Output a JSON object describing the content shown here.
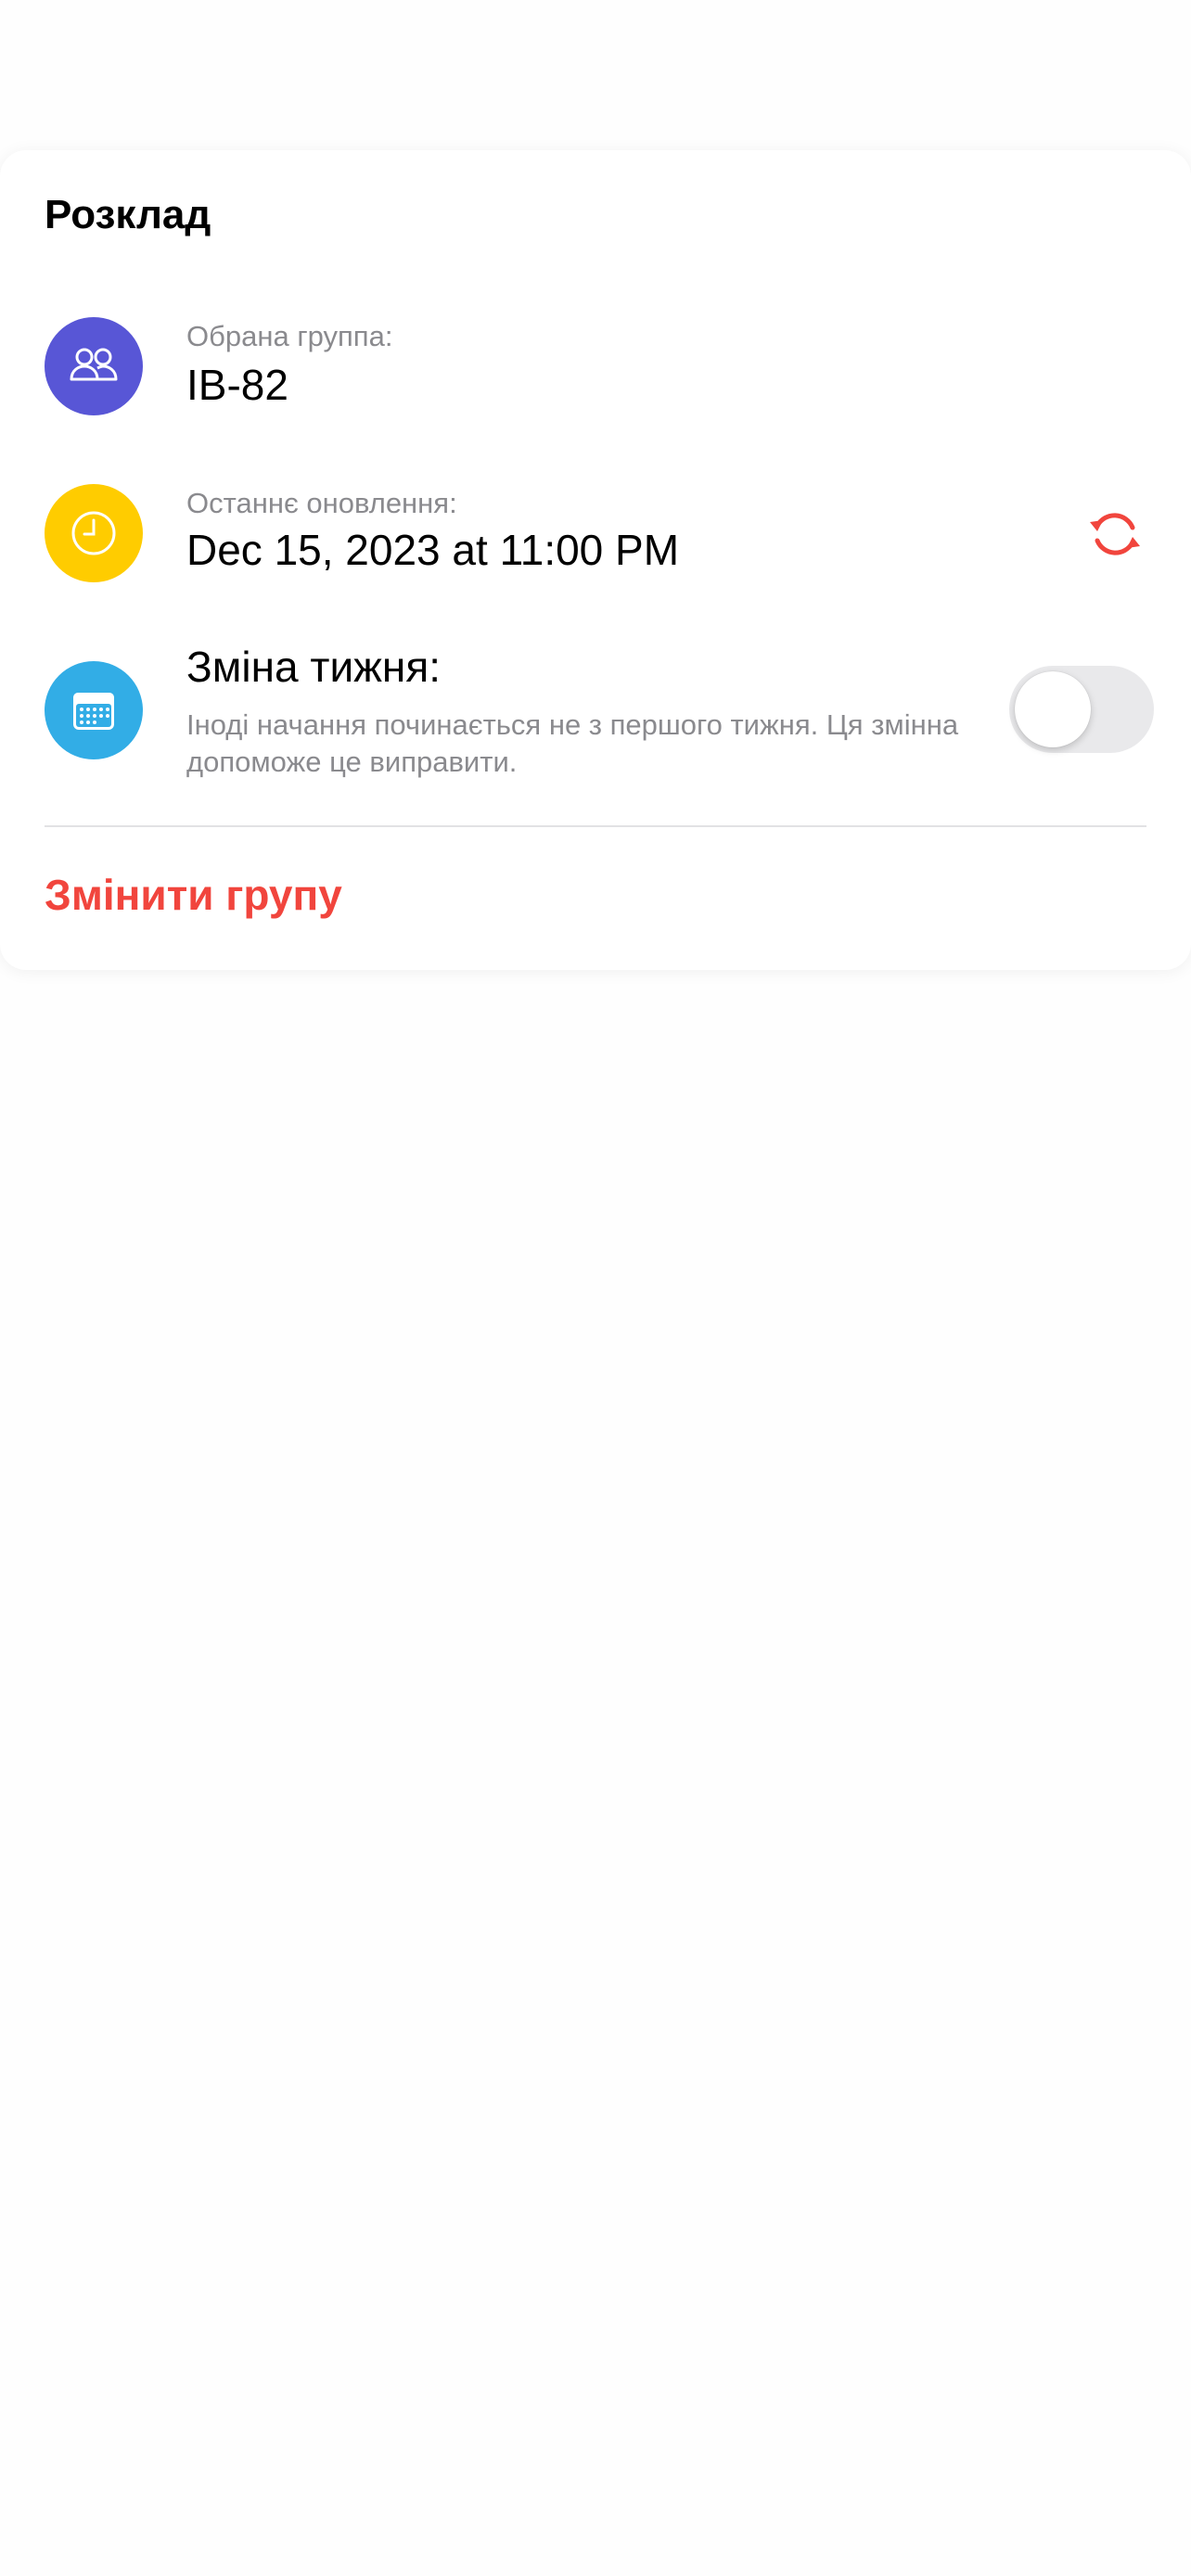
{
  "card": {
    "title": "Розклад"
  },
  "selected_group": {
    "icon": "person-2-icon",
    "label": "Обрана группа:",
    "value": "IB-82"
  },
  "last_update": {
    "icon": "clock-icon",
    "label": "Останнє оновлення:",
    "value": "Dec 15, 2023 at 11:00 PM",
    "refresh_icon": "refresh-icon"
  },
  "week_change": {
    "icon": "calendar-icon",
    "title": "Зміна тижня:",
    "description": "Іноді начання починається не з першого тижня. Ця змінна допоможе це виправити.",
    "toggle_on": false
  },
  "actions": {
    "change_group_label": "Змінити групу"
  },
  "colors": {
    "group_icon_bg": "#5856d6",
    "clock_icon_bg": "#ffcc00",
    "calendar_icon_bg": "#32ade6",
    "accent_red": "#f1453d",
    "secondary_text": "#8a8a8e",
    "toggle_off": "#e9e9eb"
  }
}
